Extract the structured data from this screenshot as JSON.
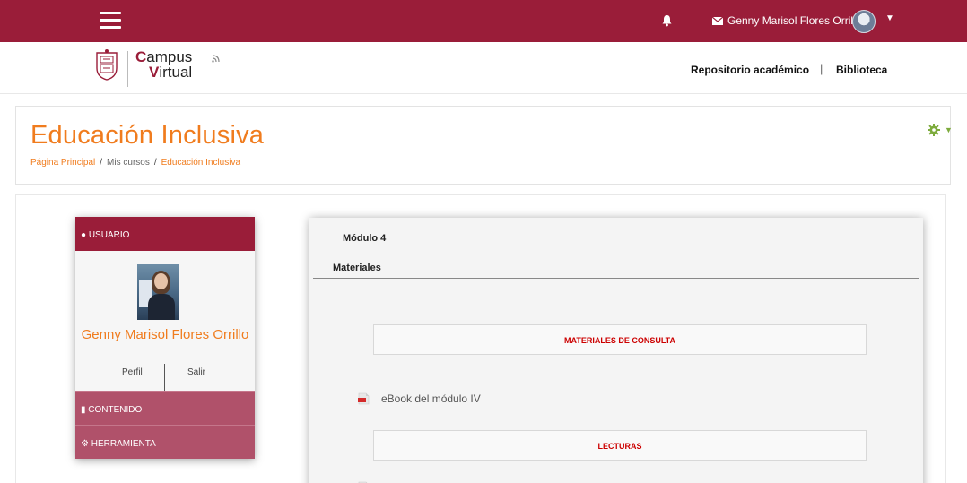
{
  "topbar": {
    "user_name": "Genny Marisol Flores Orrillo",
    "icons": [
      "hamburger-icon",
      "bell-icon",
      "envelope-icon",
      "avatar",
      "caret-down-icon"
    ],
    "color": "#9a1d39"
  },
  "header": {
    "logo_campus": "Campus",
    "logo_virtual": "Virtual",
    "nav": [
      "Repositorio académico",
      "|",
      "Biblioteca"
    ]
  },
  "page": {
    "title": "Educación Inclusiva",
    "breadcrumb": [
      "Página Principal",
      "/",
      "Mis cursos",
      "/",
      "Educación Inclusiva"
    ],
    "title_color": "#f07c1e"
  },
  "user_block": {
    "header_label": "USUARIO",
    "name": "Genny Marisol Flores Orrillo",
    "perfil": "Perfil",
    "salir": "Salir",
    "menu": [
      "CONTENIDO",
      "HERRAMIENTA"
    ]
  },
  "content": {
    "module": "Módulo 4",
    "materials": "Materiales",
    "sections": [
      "MATERIALES DE CONSULTA",
      "LECTURAS"
    ],
    "resource": "eBook del módulo IV"
  }
}
